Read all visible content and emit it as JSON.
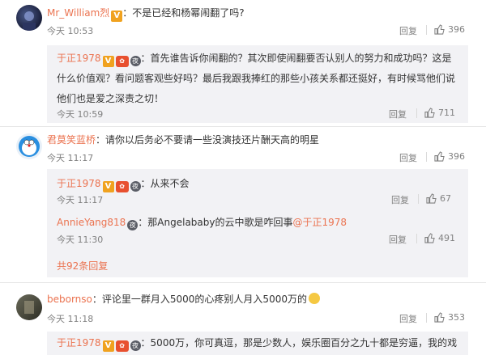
{
  "comments": [
    {
      "name": "Mr_William烈",
      "badge": "V",
      "text": "：不是已经和杨幂闹翻了吗?",
      "time": "今天 10:53",
      "reply_label": "回复",
      "likes": "396",
      "replies": [
        {
          "name": "于正1978",
          "badge_v": "V",
          "badge_vip": "💍",
          "badge_round": "夜",
          "text_lines": [
            "：首先谁告诉你闹翻的？其次即使闹翻要否认别人的努力和成功吗？这是",
            "什么价值观？看问题客观些好吗？最后我跟我捧红的那些小孩关系都还挺好，有时候骂他们说",
            "他们也是爱之深责之切！"
          ],
          "time": "今天 10:59",
          "reply_label": "回复",
          "likes": "711"
        }
      ]
    },
    {
      "name": "君莫笑蓝桥",
      "text": "：请你以后务必不要请一些没演技还片酬天高的明星",
      "time": "今天 11:17",
      "reply_label": "回复",
      "likes": "396",
      "replies": [
        {
          "name": "于正1978",
          "badge_v": "V",
          "badge_vip": "💍",
          "badge_round": "夜",
          "text": "：从来不会",
          "time": "今天 11:17",
          "reply_label": "回复",
          "likes": "67"
        },
        {
          "name": "AnnieYang818",
          "badge_round": "夜",
          "text": "：那Angelababy的云中歌是咋回事",
          "mention": "@于正1978",
          "time": "今天 11:30",
          "reply_label": "回复",
          "likes": "491"
        }
      ],
      "more_label": "共92条回复"
    },
    {
      "name": "bebornso",
      "text": "：评论里一群月入5000的心疼别人月入5000万的",
      "emoji": "😊",
      "time": "今天 11:18",
      "reply_label": "回复",
      "likes": "353",
      "replies": [
        {
          "name": "于正1978",
          "badge_v": "V",
          "badge_vip": "💍",
          "badge_round": "夜",
          "text": "：5000万，你可真逗，那是少数人，娱乐圈百分之九十都是穷逼，我的戏"
        }
      ]
    }
  ]
}
